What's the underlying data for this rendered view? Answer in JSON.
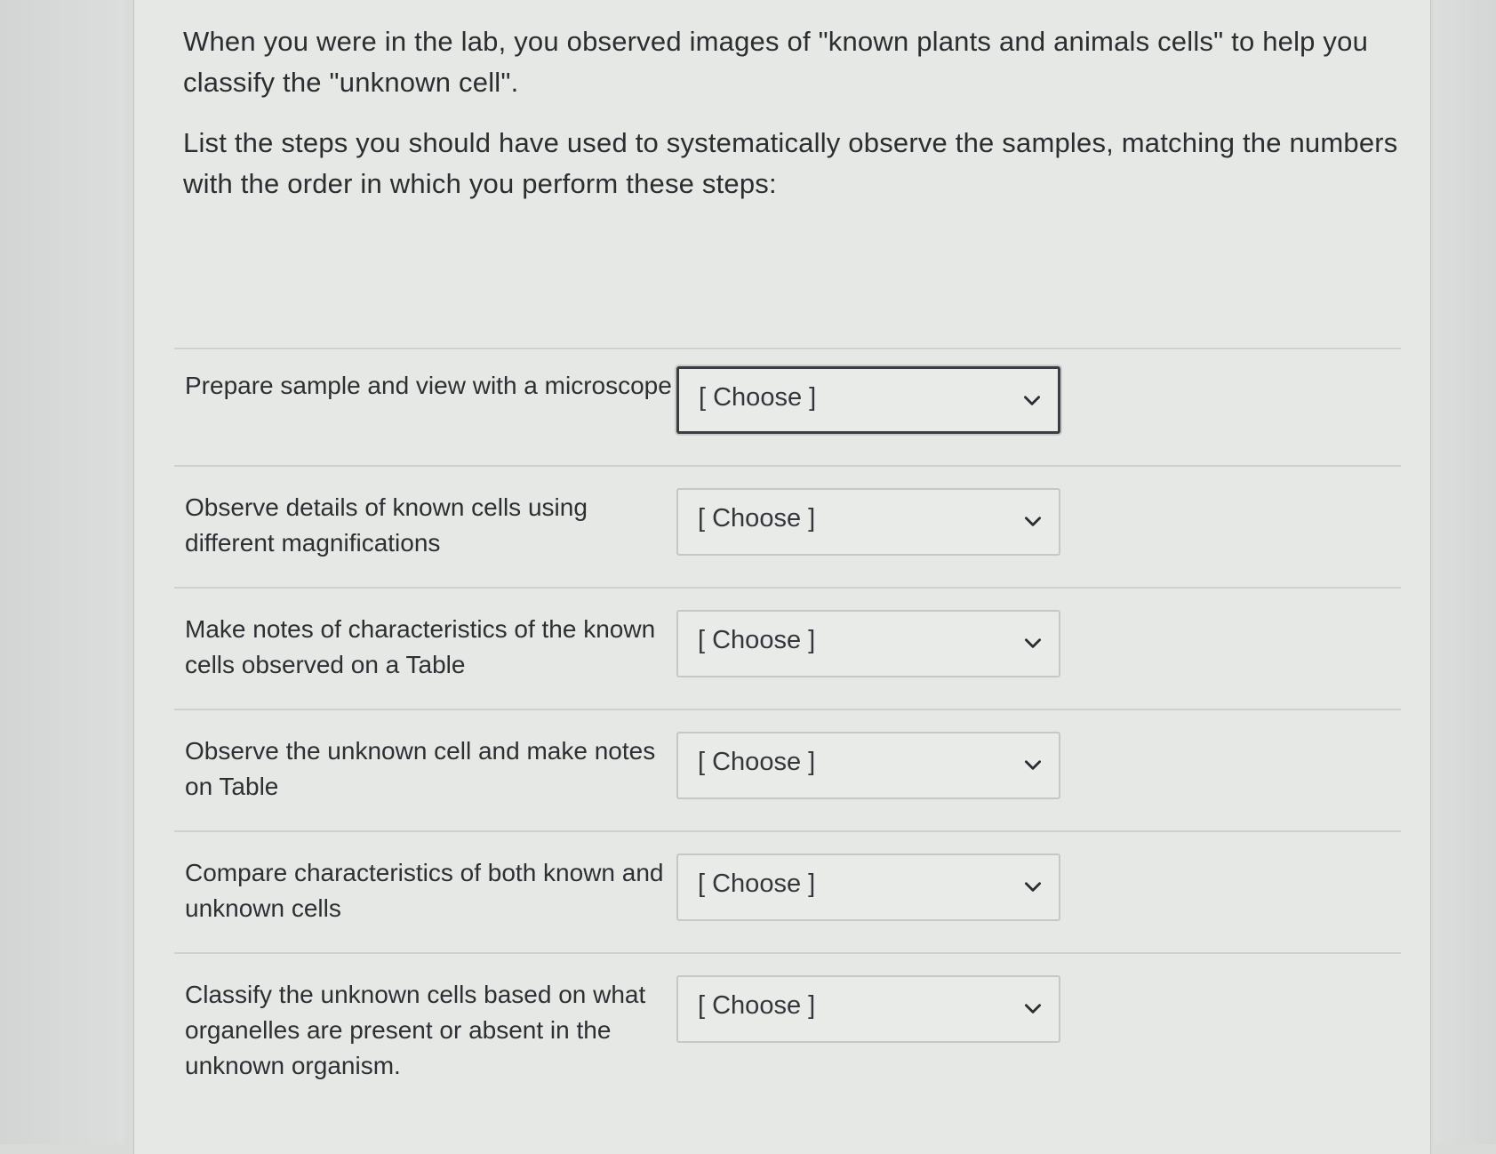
{
  "question": {
    "paragraph_1": "When you were in the lab, you observed images of \"known plants and animals cells\" to help you classify the \"unknown cell\".",
    "paragraph_2": "List the steps you should have used to systematically observe the samples, matching the numbers with the order in which you perform these steps:"
  },
  "rows": [
    {
      "label": "Prepare sample and view with a microscope",
      "select_value": "[ Choose ]"
    },
    {
      "label": "Observe details of known cells using different magnifications",
      "select_value": "[ Choose ]"
    },
    {
      "label": "Make notes of characteristics of the known cells observed on a Table",
      "select_value": "[ Choose ]"
    },
    {
      "label": "Observe the unknown cell and make notes on Table",
      "select_value": "[ Choose ]"
    },
    {
      "label": "Compare characteristics of both known and unknown cells",
      "select_value": "[ Choose ]"
    },
    {
      "label": "Classify the unknown cells based on what organelles are present or absent in the unknown organism.",
      "select_value": "[ Choose ]"
    }
  ],
  "icons": {
    "dropdown": "chevron-down-icon"
  },
  "colors": {
    "panel_background": "#e6e8e6",
    "focus_border": "#3a3d42",
    "select_border": "#c6c8c7"
  }
}
